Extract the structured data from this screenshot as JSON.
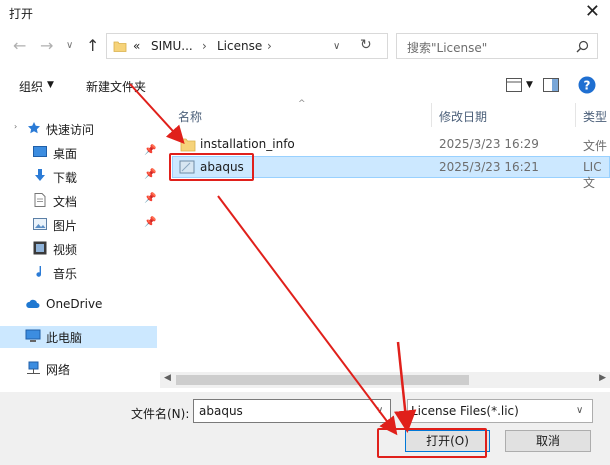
{
  "window": {
    "title": "打开"
  },
  "nav": {
    "path": [
      "«",
      "SIMU...",
      "License"
    ],
    "search_placeholder": "搜索\"License\""
  },
  "toolbar": {
    "organize": "组织",
    "new_folder": "新建文件夹"
  },
  "sidebar": {
    "items": [
      {
        "label": "快速访问"
      },
      {
        "label": "桌面"
      },
      {
        "label": "下载"
      },
      {
        "label": "文档"
      },
      {
        "label": "图片"
      },
      {
        "label": "视频"
      },
      {
        "label": "音乐"
      },
      {
        "label": "OneDrive"
      },
      {
        "label": "此电脑"
      },
      {
        "label": "网络"
      }
    ]
  },
  "columns": {
    "name": "名称",
    "date": "修改日期",
    "type": "类型"
  },
  "files": [
    {
      "name": "installation_info",
      "date": "2025/3/23 16:29",
      "type": "文件夹"
    },
    {
      "name": "abaqus",
      "date": "2025/3/23 16:21",
      "type": "LIC 文"
    }
  ],
  "footer": {
    "filename_label": "文件名(N):",
    "filename_value": "abaqus",
    "filetype": "License Files(*.lic)",
    "open": "打开(O)",
    "cancel": "取消"
  },
  "colors": {
    "selection": "#cce8ff",
    "highlight": "#e0201b",
    "accent": "#0078d7"
  }
}
